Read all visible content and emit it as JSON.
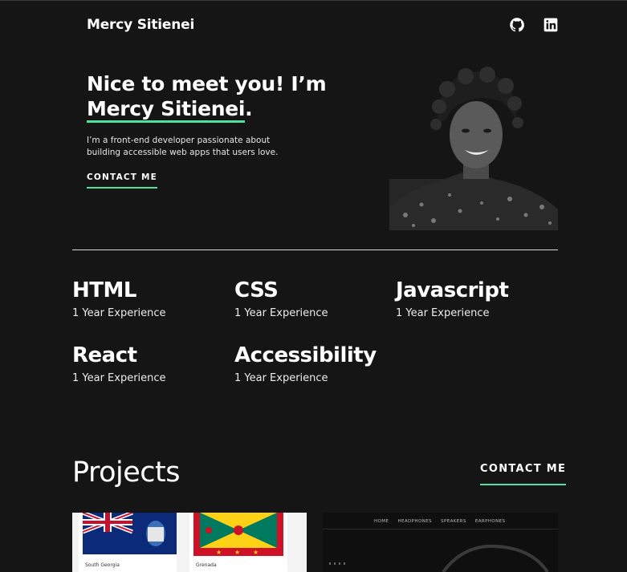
{
  "header": {
    "brand": "Mercy Sitienei",
    "social": [
      "github-icon",
      "linkedin-icon"
    ]
  },
  "hero": {
    "title_line1": "Nice to meet you! I’m",
    "title_name": "Mercy Sitienei",
    "title_end": ".",
    "description": "I’m a front-end developer passionate about building accessible web apps that users love.",
    "cta": "CONTACT ME"
  },
  "skills": [
    {
      "name": "HTML",
      "experience": "1 Year Experience"
    },
    {
      "name": "CSS",
      "experience": "1 Year Experience"
    },
    {
      "name": "Javascript",
      "experience": "1 Year Experience"
    },
    {
      "name": "React",
      "experience": "1 Year Experience"
    },
    {
      "name": "Accessibility",
      "experience": "1 Year Experience"
    }
  ],
  "projects": {
    "title": "Projects",
    "cta": "CONTACT ME",
    "items": [
      {
        "cards": [
          "South Georgia",
          "Grenada"
        ]
      },
      {
        "nav": [
          "HOME",
          "HEADPHONES",
          "SPEAKERS",
          "EARPHONES"
        ]
      }
    ]
  },
  "colors": {
    "background": "#151515",
    "accent": "#4ee1a0",
    "text": "#ffffff"
  }
}
